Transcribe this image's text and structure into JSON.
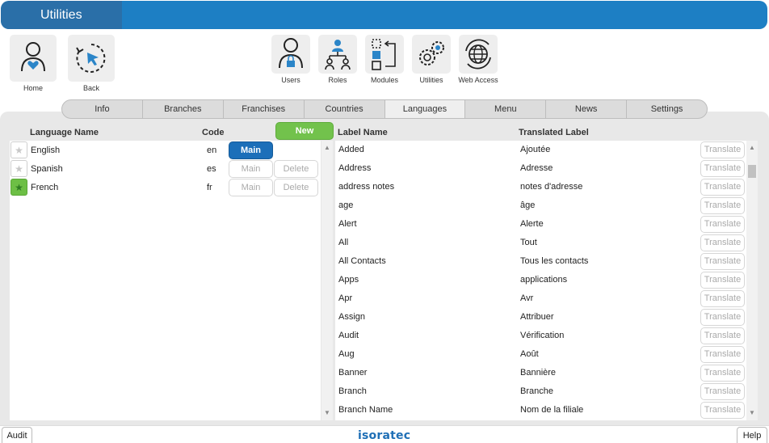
{
  "app": {
    "title": "Utilities"
  },
  "nav_left": [
    {
      "label": "Home",
      "icon": "home-user-icon"
    },
    {
      "label": "Back",
      "icon": "back-cursor-icon"
    }
  ],
  "nav_center": [
    {
      "label": "Users",
      "icon": "user-lock-icon"
    },
    {
      "label": "Roles",
      "icon": "roles-hierarchy-icon"
    },
    {
      "label": "Modules",
      "icon": "modules-icon"
    },
    {
      "label": "Utilities",
      "icon": "gears-icon"
    },
    {
      "label": "Web Access",
      "icon": "globe-icon"
    }
  ],
  "tabs": [
    "Info",
    "Branches",
    "Franchises",
    "Countries",
    "Languages",
    "Menu",
    "News",
    "Settings"
  ],
  "active_tab": "Languages",
  "languages": {
    "headers": {
      "name": "Language Name",
      "code": "Code"
    },
    "new_label": "New",
    "main_label": "Main",
    "delete_label": "Delete",
    "rows": [
      {
        "name": "English",
        "code": "en",
        "favorite": false,
        "is_main": true
      },
      {
        "name": "Spanish",
        "code": "es",
        "favorite": false,
        "is_main": false
      },
      {
        "name": "French",
        "code": "fr",
        "favorite": true,
        "is_main": false
      }
    ]
  },
  "labels": {
    "headers": {
      "name": "Label Name",
      "translated": "Translated Label"
    },
    "translate_label": "Translate",
    "rows": [
      {
        "name": "Added",
        "translated": "Ajoutée"
      },
      {
        "name": "Address",
        "translated": "Adresse"
      },
      {
        "name": "address notes",
        "translated": "notes d'adresse"
      },
      {
        "name": "age",
        "translated": "âge"
      },
      {
        "name": "Alert",
        "translated": "Alerte"
      },
      {
        "name": "All",
        "translated": "Tout"
      },
      {
        "name": "All Contacts",
        "translated": "Tous les contacts"
      },
      {
        "name": "Apps",
        "translated": "applications"
      },
      {
        "name": "Apr",
        "translated": "Avr"
      },
      {
        "name": "Assign",
        "translated": "Attribuer"
      },
      {
        "name": "Audit",
        "translated": "Vérification"
      },
      {
        "name": "Aug",
        "translated": "Août"
      },
      {
        "name": "Banner",
        "translated": "Bannière"
      },
      {
        "name": "Branch",
        "translated": "Branche"
      },
      {
        "name": "Branch Name",
        "translated": "Nom de la filiale"
      }
    ]
  },
  "footer": {
    "audit": "Audit",
    "help": "Help",
    "logo": "isoratec"
  },
  "colors": {
    "header_blue": "#1d7fc4",
    "main_blue": "#1c6fb9",
    "new_green": "#72c24c",
    "fav_green": "#6dbf45"
  }
}
